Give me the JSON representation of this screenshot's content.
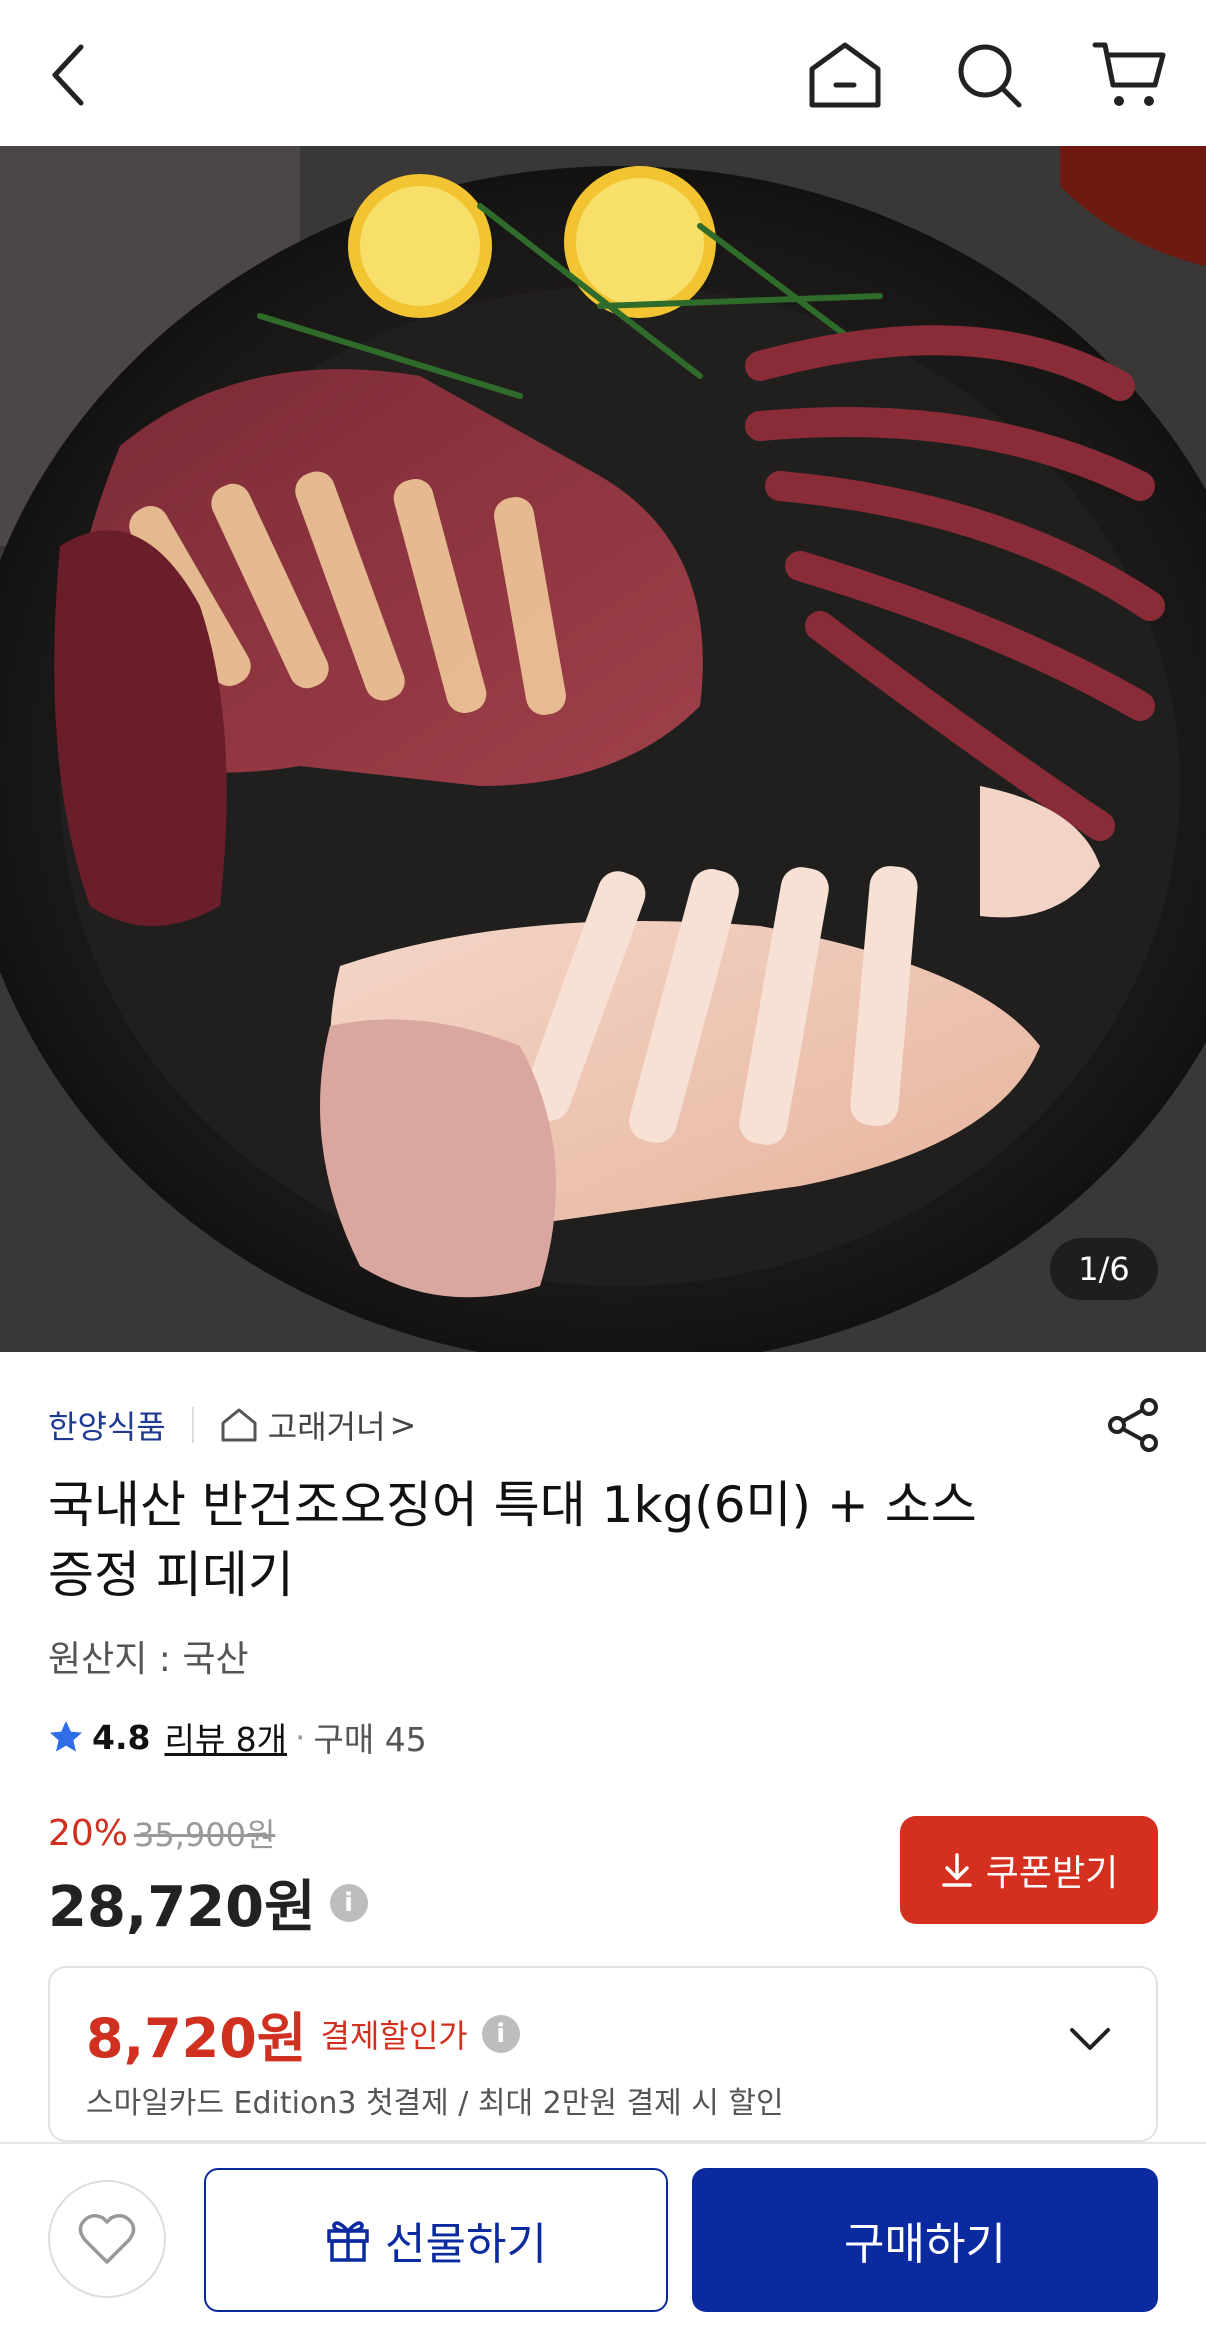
{
  "image_counter": "1/6",
  "store": {
    "seller": "한양식품",
    "shop_name": "고래거너",
    "shop_arrow": ">"
  },
  "product": {
    "title_line1": "국내산 반건조오징어 특대 1kg(6미) + 소스",
    "title_line2": "증정 피데기",
    "origin": "원산지 : 국산",
    "rating": "4.8",
    "reviews": "리뷰 8개",
    "bought": "구매 45"
  },
  "pricing": {
    "discount_pct": "20%",
    "original_price": "35,900원",
    "sale_price": "28,720원",
    "coupon_button": "쿠폰받기"
  },
  "card_offer": {
    "price": "8,720원",
    "label": "결제할인가",
    "description": "스마일카드 Edition3 첫결제 / 최대 2만원 결제 시 할인"
  },
  "bottom_bar": {
    "gift_label": "선물하기",
    "buy_label": "구매하기"
  },
  "colors": {
    "accent_red": "#d42f1f",
    "brand_blue": "#0b2aa0",
    "seller_blue": "#1f3a93"
  },
  "icons": [
    "back-icon",
    "home-icon",
    "search-icon",
    "cart-icon",
    "share-icon",
    "shop-home-icon",
    "star-icon",
    "info-icon",
    "download-icon",
    "chevron-down-icon",
    "heart-icon",
    "gift-icon"
  ]
}
